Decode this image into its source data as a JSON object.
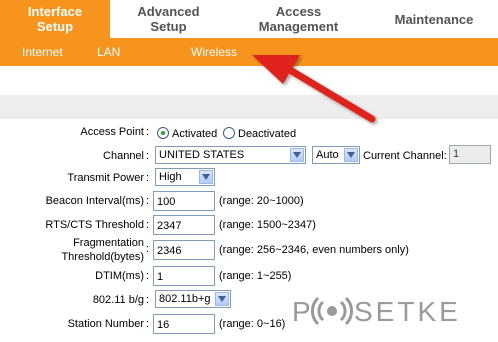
{
  "tabs": [
    {
      "line1": "Interface",
      "line2": "Setup"
    },
    {
      "line1": "Advanced",
      "line2": "Setup"
    },
    {
      "line1": "Access",
      "line2": "Management"
    },
    {
      "line1": "Maintenance",
      "line2": ""
    }
  ],
  "subnav": [
    "Internet",
    "LAN",
    "Wireless"
  ],
  "form": {
    "access_point": {
      "label": "Access Point",
      "opt_on": "Activated",
      "opt_off": "Deactivated",
      "selected": "Activated"
    },
    "channel": {
      "label": "Channel",
      "country": "UNITED STATES",
      "mode": "Auto",
      "current_label": "Current Channel:",
      "current_value": "1"
    },
    "transmit_power": {
      "label": "Transmit Power",
      "value": "High"
    },
    "beacon": {
      "label": "Beacon Interval(ms)",
      "value": "100",
      "hint": "(range: 20~1000)"
    },
    "rts": {
      "label": "RTS/CTS Threshold",
      "value": "2347",
      "hint": "(range: 1500~2347)"
    },
    "frag": {
      "label1": "Fragmentation",
      "label2": "Threshold(bytes)",
      "value": "2346",
      "hint": "(range: 256~2346, even numbers only)"
    },
    "dtim": {
      "label": "DTIM(ms)",
      "value": "1",
      "hint": "(range: 1~255)"
    },
    "mode": {
      "label": "802.11 b/g",
      "value": "802.11b+g"
    },
    "station": {
      "label": "Station Number",
      "value": "16",
      "hint": "(range: 0~16)"
    }
  },
  "colon": ":",
  "watermark": {
    "text": "P(( ))SETKE",
    "color": "#9a9a9a"
  },
  "colors": {
    "orange": "#f7941d",
    "arrow": "#e0231e"
  }
}
